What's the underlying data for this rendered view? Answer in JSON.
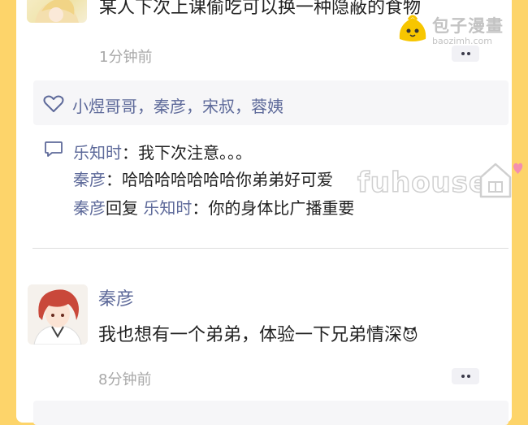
{
  "post_prev": {
    "content": "某人下次上课偷吃可以换一种隐蔽的食物",
    "time": "1分钟前"
  },
  "likes": {
    "names": "小煜哥哥，秦彦，宋叔，蓉姨"
  },
  "replies": [
    {
      "user": "乐知时",
      "sep": "：",
      "text": "我下次注意。。。"
    },
    {
      "user": "秦彦",
      "sep": "：",
      "text": "哈哈哈哈哈哈哈你弟弟好可爱"
    },
    {
      "user": "秦彦",
      "mid": "回复 ",
      "target": "乐知时",
      "sep": "：",
      "text": "你的身体比广播重要"
    }
  ],
  "post": {
    "username": "秦彦",
    "content": "我也想有一个弟弟，体验一下兄弟情深",
    "emoji": "😈",
    "time": "8分钟前"
  },
  "watermark": {
    "brand": "包子漫畫",
    "url": "baozimh.com",
    "site": "fuhouse"
  },
  "colors": {
    "background": "#fdd46a",
    "username": "#5e6a9a",
    "time": "#a9a9a9"
  }
}
